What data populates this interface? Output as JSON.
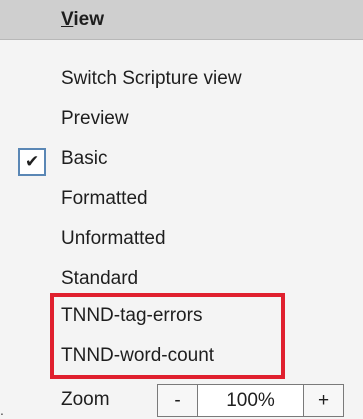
{
  "menu": {
    "title_mnemonic": "V",
    "title_rest": "iew",
    "items": [
      {
        "label": "Switch Scripture view",
        "checked": false
      },
      {
        "label": "Preview",
        "checked": false
      },
      {
        "label": "Basic",
        "checked": true
      },
      {
        "label": "Formatted",
        "checked": false
      },
      {
        "label": "Unformatted",
        "checked": false
      },
      {
        "label": "Standard",
        "checked": false
      },
      {
        "label": "TNND-tag-errors",
        "checked": false
      },
      {
        "label": "TNND-word-count",
        "checked": false
      }
    ],
    "check_glyph": "✔",
    "highlight_color": "#e0202e"
  },
  "zoom": {
    "label": "Zoom",
    "decrease": "-",
    "value": "100%",
    "increase": "+"
  },
  "edge_mark": "."
}
